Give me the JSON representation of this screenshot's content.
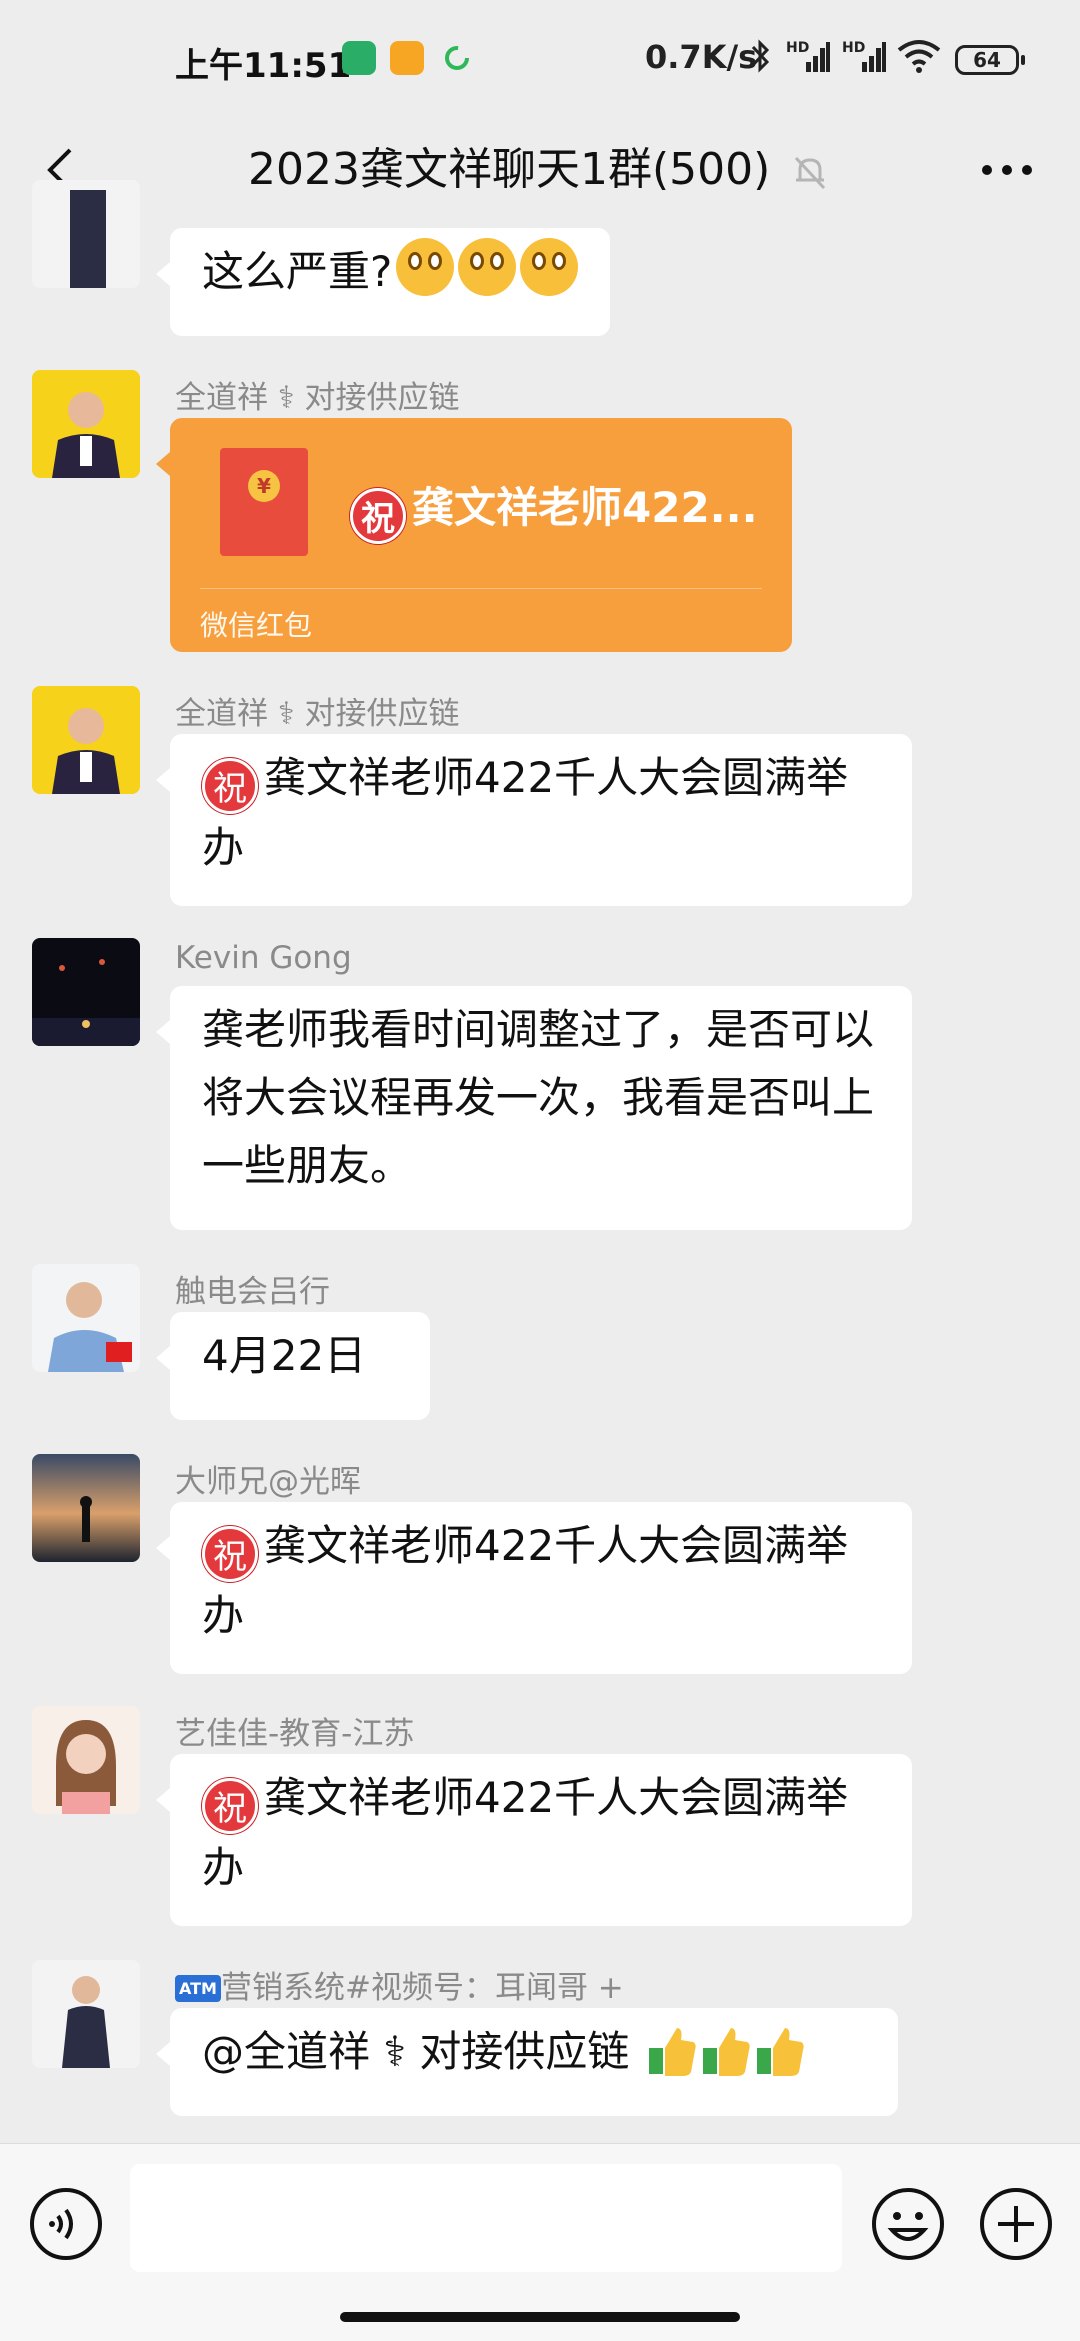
{
  "status_bar": {
    "time": "上午11:51",
    "speed": "0.7K/s",
    "battery": "64",
    "hd1": "HD",
    "hd2": "HD"
  },
  "header": {
    "title": "2023龚文祥聊天1群(500)"
  },
  "messages": [
    {
      "sender": "",
      "text": "这么严重?"
    },
    {
      "sender": "全道祥 ⚕ 对接供应链",
      "red_packet_title": "龚文祥老师422...",
      "red_packet_label": "微信红包"
    },
    {
      "sender": "全道祥 ⚕ 对接供应链",
      "text": "龚文祥老师422千人大会圆满举办"
    },
    {
      "sender": "Kevin Gong",
      "text": "龚老师我看时间调整过了，是否可以将大会议程再发一次，我看是否叫上一些朋友。"
    },
    {
      "sender": "触电会吕行",
      "text": "4月22日"
    },
    {
      "sender": "大师兄@光晖",
      "text": "龚文祥老师422千人大会圆满举办"
    },
    {
      "sender": "艺佳佳-教育-江苏",
      "text": "龚文祥老师422千人大会圆满举办"
    },
    {
      "sender": "营销系统#视频号：耳闻哥 +",
      "sender_badge": "ATM",
      "text": "@全道祥 ⚕ 对接供应链"
    }
  ],
  "glyphs": {
    "zhu": "祝",
    "yuan": "¥"
  },
  "colors": {
    "accent_orange": "#f79e3d",
    "background": "#ededed",
    "bubble": "#ffffff"
  }
}
